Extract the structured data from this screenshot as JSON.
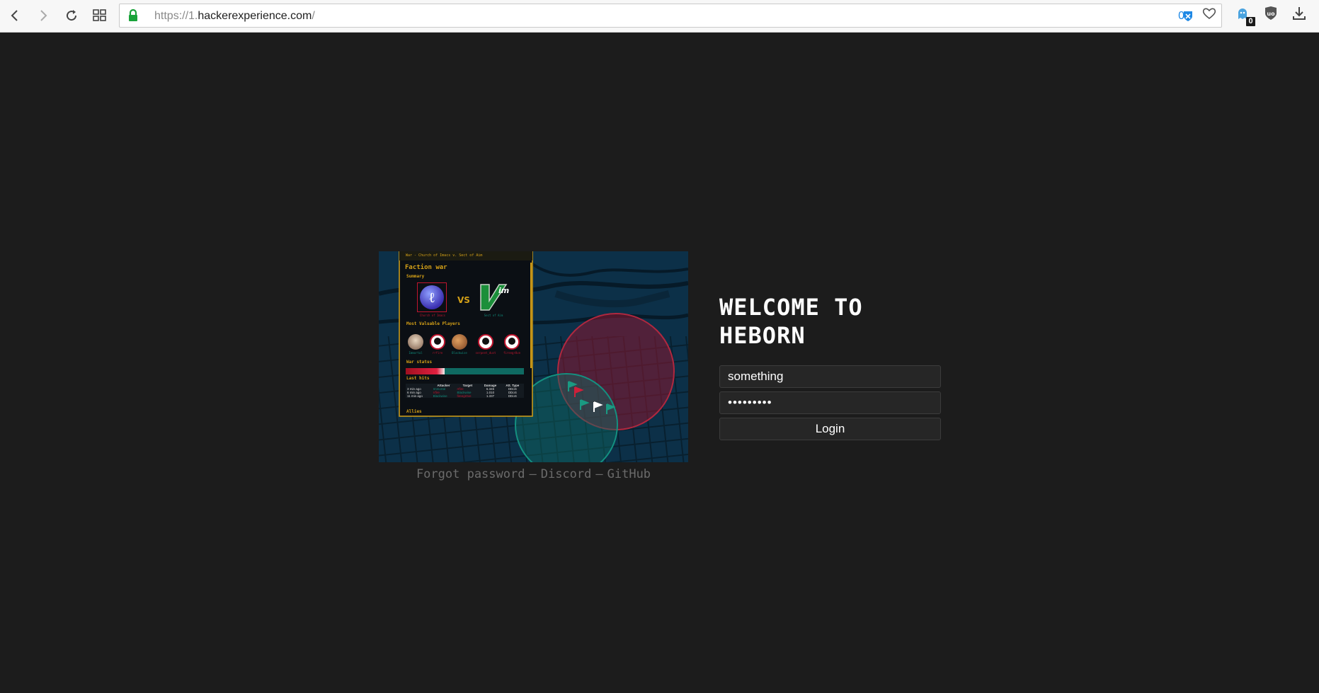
{
  "browser": {
    "url_prefix": "https://1.",
    "url_domain": "hackerexperience.com",
    "url_suffix": "/",
    "bitwarden_count": "0",
    "extension_badge": "0"
  },
  "preview": {
    "window_title": "War - Church of Imacs v. Sect of Aim",
    "panel_title": "Faction war",
    "summary_label": "Summary",
    "faction_a": "Church of Imacs",
    "faction_b": "Sect of Aim",
    "vs": "VS",
    "mvp_label": "Most Valuable Players",
    "players": [
      "Immortal",
      "rrfire",
      "Blackwise",
      "serpent_dust",
      "fireegr0ve"
    ],
    "war_status_label": "War status",
    "war_status_fraction": 0.33,
    "last_hits_label": "Last hits",
    "table_headers": [
      "",
      "Attacker",
      "Target",
      "Damage",
      "Att. Type"
    ],
    "table_rows": [
      [
        "3 min ago",
        "Immortal",
        "rrfire",
        "6.345",
        "DDoS"
      ],
      [
        "6 min ago",
        "rrfire",
        "Blackwise",
        "1.010",
        "DDoS"
      ],
      [
        "11 min ago",
        "Blackwise",
        "fireegr0ve",
        "1.337",
        "DDoS"
      ]
    ],
    "allies_label": "Allies"
  },
  "links": {
    "forgot": "Forgot password",
    "discord": "Discord",
    "github": "GitHub",
    "separator": "–"
  },
  "login": {
    "welcome": "WELCOME TO HEBORN",
    "username_value": "something",
    "password_value": "something",
    "button": "Login"
  },
  "colors": {
    "background": "#1c1c1c",
    "accent_gold": "#d4a017",
    "faction_red": "#c0152e",
    "faction_teal": "#0f8a7a"
  }
}
